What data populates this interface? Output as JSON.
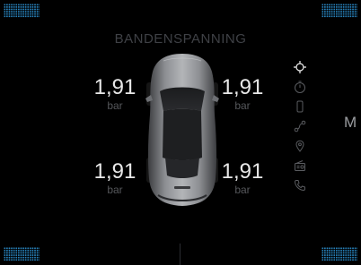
{
  "header": {
    "title": "BANDENSPANNING"
  },
  "tires": {
    "front_left": {
      "value": "1,91",
      "unit": "bar"
    },
    "front_right": {
      "value": "1,91",
      "unit": "bar"
    },
    "rear_left": {
      "value": "1,91",
      "unit": "bar"
    },
    "rear_right": {
      "value": "1,91",
      "unit": "bar"
    }
  },
  "side_nav": {
    "items": [
      {
        "icon": "tire-pressure-icon",
        "active": true
      },
      {
        "icon": "timer-icon"
      },
      {
        "icon": "phone-device-icon"
      },
      {
        "icon": "route-icon"
      },
      {
        "icon": "location-pin-icon"
      },
      {
        "icon": "radio-icon"
      },
      {
        "icon": "phone-call-icon"
      }
    ]
  },
  "edge": {
    "letter": "M"
  },
  "colors": {
    "background": "#000000",
    "accent": "#2f9be0",
    "value_text": "#e8e8e8",
    "muted_text": "#55575b",
    "title_text": "#3f4146"
  }
}
